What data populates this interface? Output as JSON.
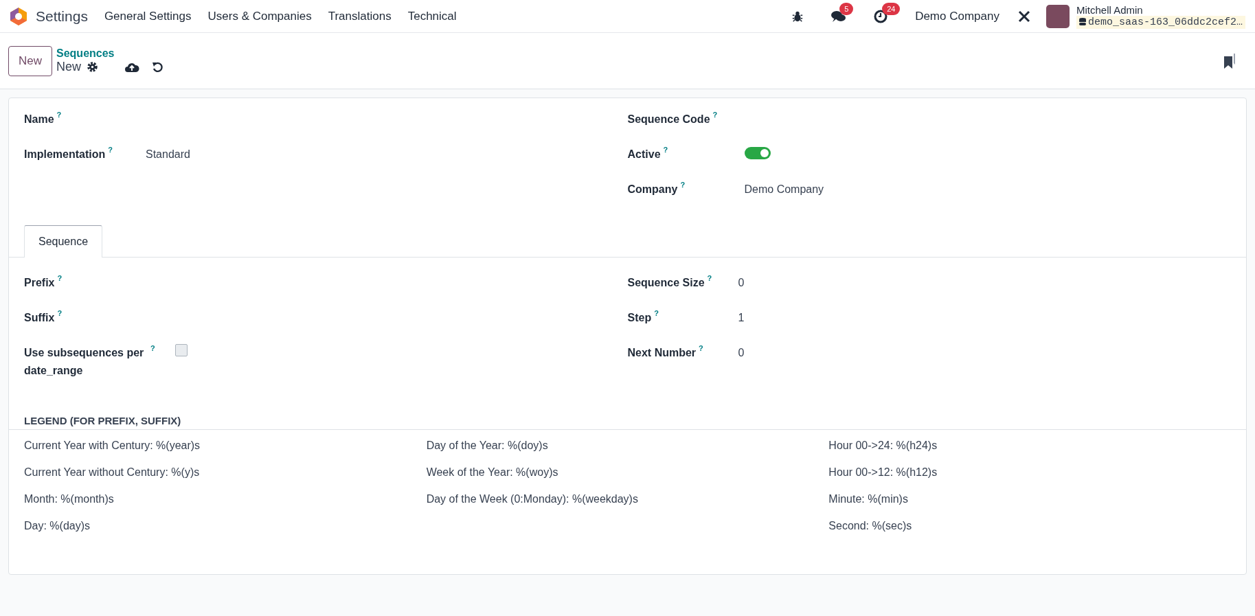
{
  "navbar": {
    "app_name": "Settings",
    "menu": [
      "General Settings",
      "Users & Companies",
      "Translations",
      "Technical"
    ],
    "messages_badge": "5",
    "activities_badge": "24",
    "company": "Demo Company",
    "user_name": "Mitchell Admin",
    "database": "demo_saas-163_06ddc2cef2…"
  },
  "control_panel": {
    "new_button": "New",
    "breadcrumb": "Sequences",
    "record": "New"
  },
  "form": {
    "left_fields": [
      {
        "label": "Name",
        "help": "?"
      },
      {
        "label": "Implementation",
        "help": "?",
        "value": "Standard"
      }
    ],
    "right_fields": [
      {
        "label": "Sequence Code",
        "help": "?",
        "kind": "text"
      },
      {
        "label": "Active",
        "help": "?",
        "kind": "toggle",
        "on": true
      },
      {
        "label": "Company",
        "help": "?",
        "kind": "text",
        "value": "Demo Company"
      }
    ],
    "tabs": [
      {
        "label": "Sequence",
        "selected": true
      }
    ],
    "tab_left_fields": [
      {
        "label": "Prefix",
        "help": "?",
        "kind": "text"
      },
      {
        "label": "Suffix",
        "help": "?",
        "kind": "text"
      },
      {
        "label": "Use subsequences per date_range",
        "help": "?",
        "kind": "checkbox",
        "checked": false
      }
    ],
    "tab_right_fields": [
      {
        "label": "Sequence Size",
        "help": "?",
        "value": "0"
      },
      {
        "label": "Step",
        "help": "?",
        "value": "1"
      },
      {
        "label": "Next Number",
        "help": "?",
        "value": "0"
      }
    ],
    "legend": {
      "title": "LEGEND (FOR PREFIX, SUFFIX)",
      "columns": [
        [
          "Current Year with Century: %(year)s",
          "Current Year without Century: %(y)s",
          "Month: %(month)s",
          "Day: %(day)s"
        ],
        [
          "Day of the Year: %(doy)s",
          "Week of the Year: %(woy)s",
          "Day of the Week (0:Monday): %(weekday)s"
        ],
        [
          "Hour 00->24: %(h24)s",
          "Hour 00->12: %(h12)s",
          "Minute: %(min)s",
          "Second: %(sec)s"
        ]
      ]
    }
  }
}
